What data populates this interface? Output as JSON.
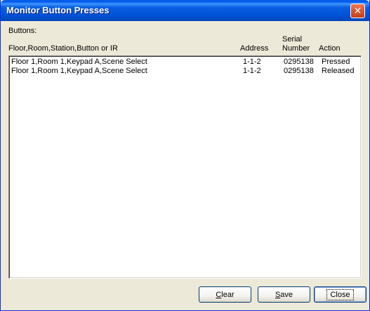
{
  "window": {
    "title": "Monitor Button Presses",
    "close_glyph": "✕"
  },
  "buttons_label": "Buttons:",
  "columns": {
    "name": "Floor,Room,Station,Button or IR",
    "address": "Address",
    "serial_line1": "Serial",
    "serial_line2": "Number",
    "action": "Action"
  },
  "rows": [
    {
      "name": "Floor 1,Room 1,Keypad A,Scene Select",
      "address": "1-1-2",
      "serial": "0295138",
      "action": "Pressed"
    },
    {
      "name": "Floor 1,Room 1,Keypad A,Scene Select",
      "address": "1-1-2",
      "serial": "0295138",
      "action": "Released"
    }
  ],
  "footer": {
    "clear": {
      "mnemonic": "C",
      "rest": "lear"
    },
    "save": {
      "mnemonic": "S",
      "rest": "ave"
    },
    "close": "Close"
  }
}
